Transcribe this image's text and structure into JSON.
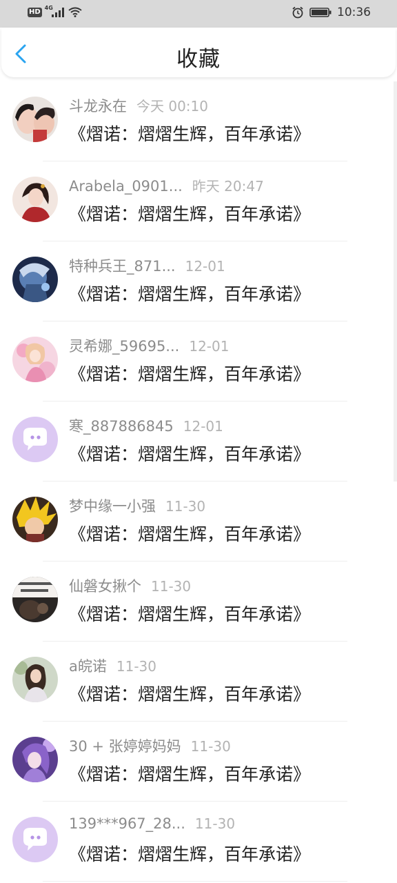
{
  "status_bar": {
    "hd": "HD",
    "network": "4G",
    "time": "10:36"
  },
  "header": {
    "title": "收藏",
    "back_icon": "chevron-left-icon",
    "accent_color": "#2aa4f0"
  },
  "items": [
    {
      "name": "斗龙永在",
      "time": "今天 00:10",
      "message": "《熠诺：熠熠生辉，百年承诺》",
      "avatar": "photo"
    },
    {
      "name": "Arabela_0901...",
      "time": "昨天 20:47",
      "message": "《熠诺：熠熠生辉，百年承诺》",
      "avatar": "photo"
    },
    {
      "name": "特种兵王_871...",
      "time": "12-01",
      "message": "《熠诺：熠熠生辉，百年承诺》",
      "avatar": "photo"
    },
    {
      "name": "灵希娜_59695...",
      "time": "12-01",
      "message": "《熠诺：熠熠生辉，百年承诺》",
      "avatar": "photo"
    },
    {
      "name": "寒_887886845",
      "time": "12-01",
      "message": "《熠诺：熠熠生辉，百年承诺》",
      "avatar": "default-chat-icon"
    },
    {
      "name": "梦中缘一小强",
      "time": "11-30",
      "message": "《熠诺：熠熠生辉，百年承诺》",
      "avatar": "photo"
    },
    {
      "name": "仙磐女揪个",
      "time": "11-30",
      "message": "《熠诺：熠熠生辉，百年承诺》",
      "avatar": "photo"
    },
    {
      "name": "a皖诺",
      "time": "11-30",
      "message": "《熠诺：熠熠生辉，百年承诺》",
      "avatar": "photo"
    },
    {
      "name": "30 + 张婷婷妈妈",
      "time": "11-30",
      "message": "《熠诺：熠熠生辉，百年承诺》",
      "avatar": "photo"
    },
    {
      "name": "139***967_28...",
      "time": "11-30",
      "message": "《熠诺：熠熠生辉，百年承诺》",
      "avatar": "default-chat-icon"
    }
  ]
}
